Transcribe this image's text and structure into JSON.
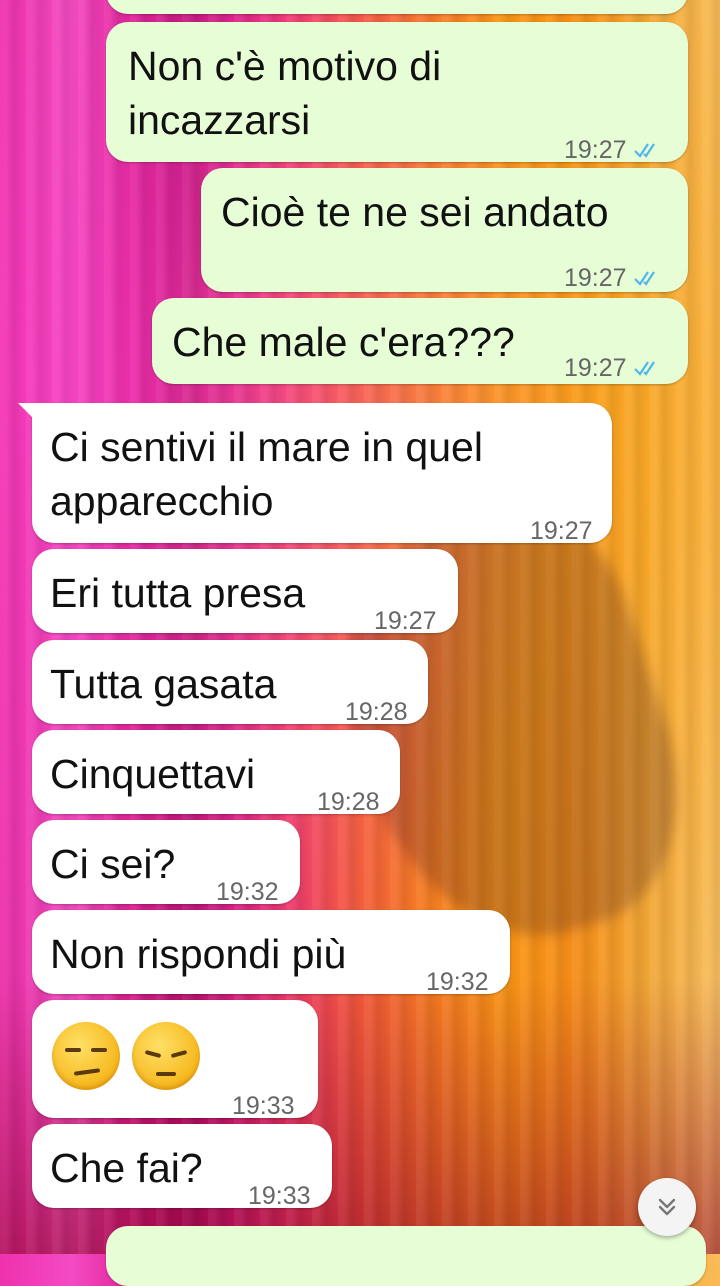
{
  "messages": [
    {
      "id": "m1",
      "direction": "out",
      "lines": [
        "Non c'è motivo di",
        "incazzarsi"
      ],
      "time": "19:27",
      "read": true
    },
    {
      "id": "m2",
      "direction": "out",
      "lines": [
        "Cioè te ne sei andato"
      ],
      "time": "19:27",
      "read": true
    },
    {
      "id": "m3",
      "direction": "out",
      "lines": [
        "Che male c'era???"
      ],
      "time": "19:27",
      "read": true
    },
    {
      "id": "m4",
      "direction": "in",
      "lines": [
        "Ci sentivi il mare in quel",
        "apparecchio"
      ],
      "time": "19:27"
    },
    {
      "id": "m5",
      "direction": "in",
      "lines": [
        "Eri tutta presa"
      ],
      "time": "19:27"
    },
    {
      "id": "m6",
      "direction": "in",
      "lines": [
        "Tutta gasata"
      ],
      "time": "19:28"
    },
    {
      "id": "m7",
      "direction": "in",
      "lines": [
        "Cinquettavi"
      ],
      "time": "19:28"
    },
    {
      "id": "m8",
      "direction": "in",
      "lines": [
        "Ci sei?"
      ],
      "time": "19:32"
    },
    {
      "id": "m9",
      "direction": "in",
      "lines": [
        "Non rispondi più"
      ],
      "time": "19:32"
    },
    {
      "id": "m10",
      "direction": "in",
      "emojis": [
        "unamused-face",
        "pensive-face"
      ],
      "time": "19:33"
    },
    {
      "id": "m11",
      "direction": "in",
      "lines": [
        "Che fai?"
      ],
      "time": "19:33"
    }
  ],
  "icons": {
    "read_receipt": "double-check-icon",
    "scroll_down": "chevron-double-down-icon"
  },
  "colors": {
    "outgoing_bubble": "#e7fdd6",
    "incoming_bubble": "#ffffff",
    "read_tick": "#4fb6ec",
    "timestamp": "#666666"
  }
}
